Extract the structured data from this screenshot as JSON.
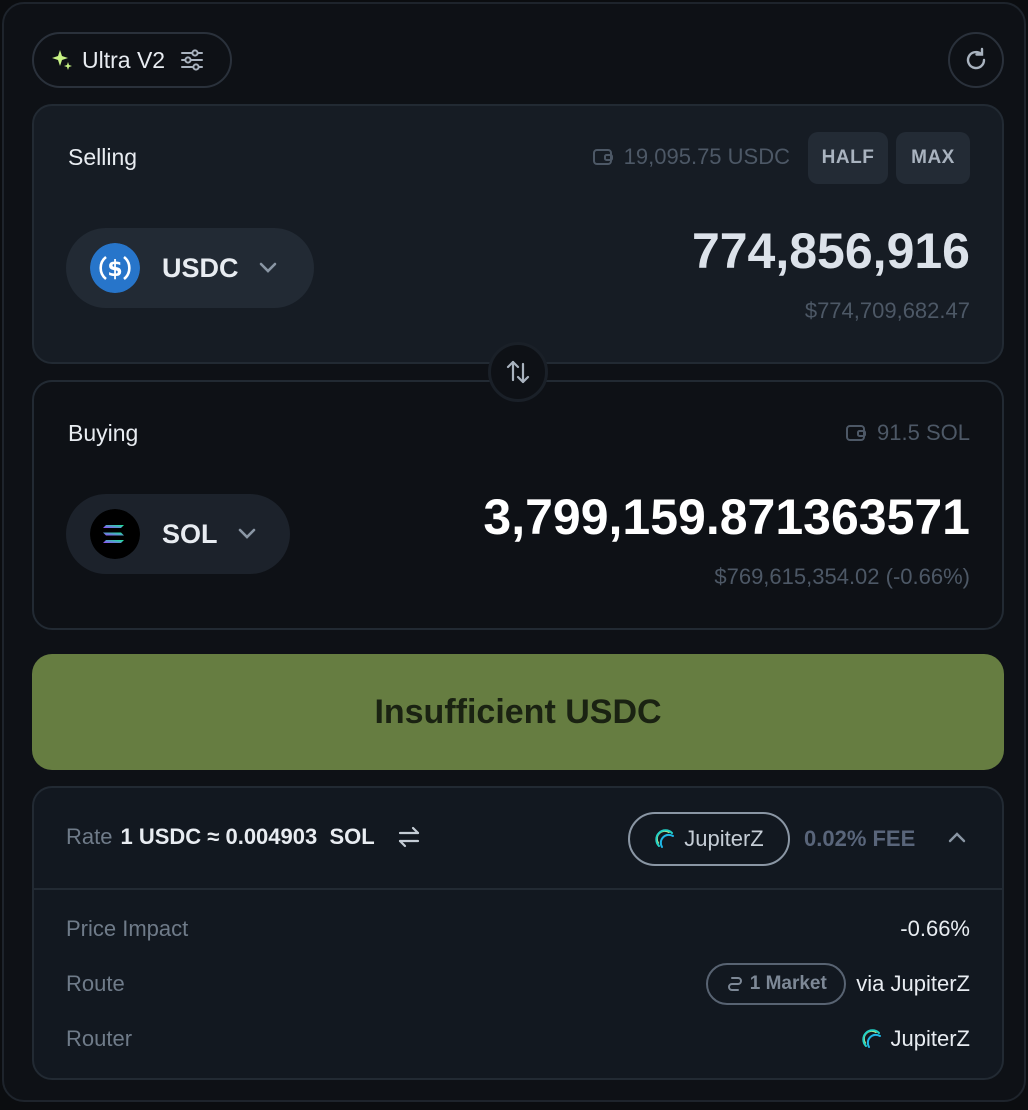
{
  "header": {
    "mode_label": "Ultra V2"
  },
  "selling": {
    "title": "Selling",
    "balance": "19,095.75 USDC",
    "half_label": "HALF",
    "max_label": "MAX",
    "token": "USDC",
    "amount": "774,856,916",
    "usd_value": "$774,709,682.47"
  },
  "buying": {
    "title": "Buying",
    "balance": "91.5 SOL",
    "token": "SOL",
    "amount": "3,799,159.871363571",
    "usd_value": "$769,615,354.02 (-0.66%)"
  },
  "cta": {
    "label": "Insufficient USDC"
  },
  "details": {
    "rate_label": "Rate",
    "rate_value": "1 USDC ≈ 0.004903  SOL",
    "router_name": "JupiterZ",
    "fee": "0.02% FEE",
    "rows": {
      "price_impact": {
        "label": "Price Impact",
        "value": "-0.66%"
      },
      "route": {
        "label": "Route",
        "market": "1 Market",
        "value": "via JupiterZ"
      },
      "router": {
        "label": "Router",
        "value": "JupiterZ"
      }
    }
  },
  "colors": {
    "cta_bg": "#667d41",
    "usdc_blue": "#2775ca",
    "spark": "#c7f284"
  },
  "icons": [
    "sparkle-icon",
    "settings-sliders-icon",
    "refresh-icon",
    "wallet-icon",
    "usdc-logo",
    "sol-logo",
    "chevron-down-icon",
    "swap-arrows-icon",
    "invert-rate-icon",
    "jupiterz-logo",
    "chevron-up-icon",
    "route-icon"
  ]
}
